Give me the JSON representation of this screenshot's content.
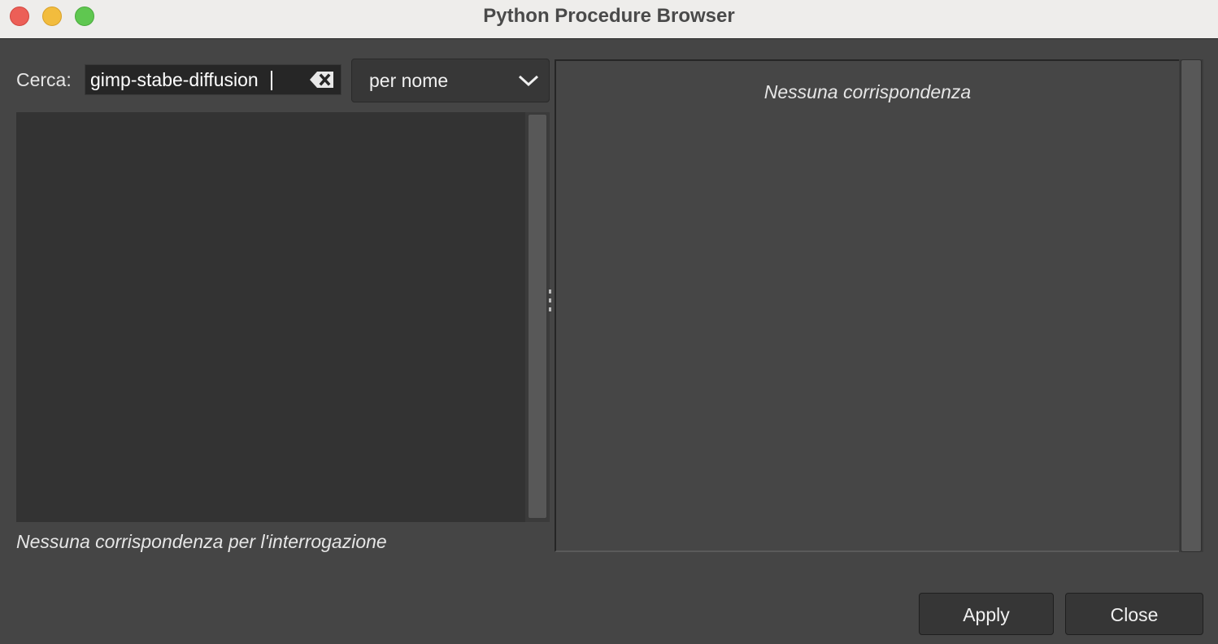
{
  "window": {
    "title": "Python Procedure Browser",
    "controls": [
      "close",
      "minimize",
      "zoom"
    ]
  },
  "search": {
    "label": "Cerca:",
    "value": "gimp-stabe-diffusion",
    "clear_icon": "clear-text-icon"
  },
  "filter": {
    "selected": "per nome",
    "icon": "chevron-down-icon"
  },
  "procedure_list": {
    "items": [],
    "status": "Nessuna corrispondenza per l'interrogazione"
  },
  "details": {
    "message": "Nessuna corrispondenza"
  },
  "buttons": {
    "apply": "Apply",
    "close": "Close"
  },
  "colors": {
    "background": "#454545",
    "titlebar": "#eeedeb",
    "traffic_close": "#ec5f57",
    "traffic_minimize": "#f2bc3d",
    "traffic_zoom": "#5fc750"
  }
}
